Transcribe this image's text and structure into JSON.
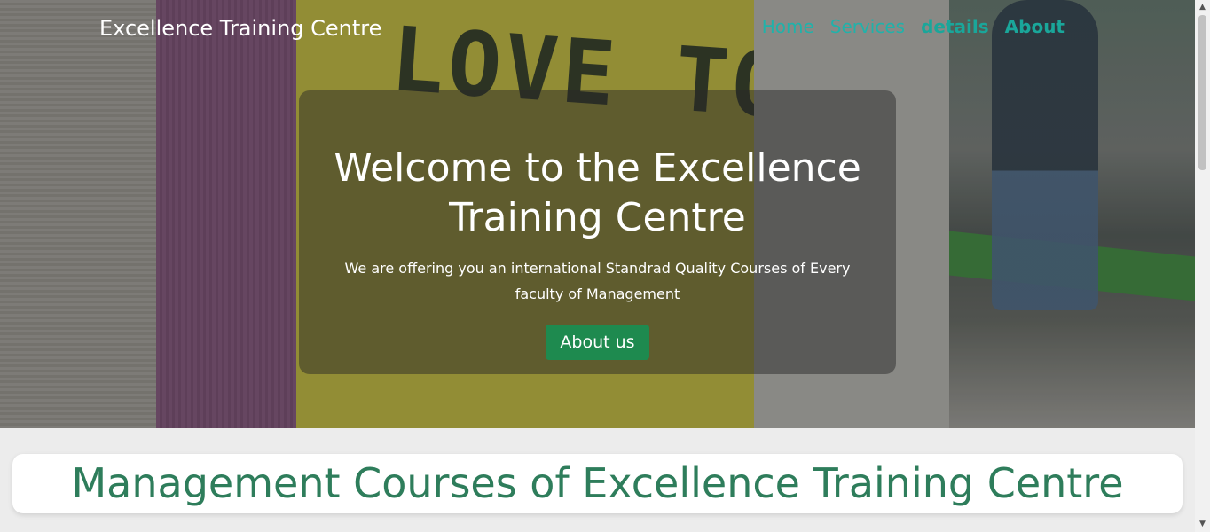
{
  "brand": {
    "name": "Excellence Training Centre"
  },
  "nav": {
    "items": [
      {
        "label": "Home"
      },
      {
        "label": "Services"
      },
      {
        "label": "details"
      },
      {
        "label": "About"
      }
    ]
  },
  "hero": {
    "title": "Welcome to the Excellence Training Centre",
    "subtitle": "We are offering you an international Standrad Quality Courses of Every faculty of Management",
    "button_label": "About us",
    "sign_text": "LOVE TO LEARN"
  },
  "courses": {
    "title": "Management Courses of Excellence Training Centre"
  },
  "colors": {
    "accent": "#1e8a4f",
    "nav_link": "#20b2aa",
    "heading": "#2e7d5b"
  }
}
